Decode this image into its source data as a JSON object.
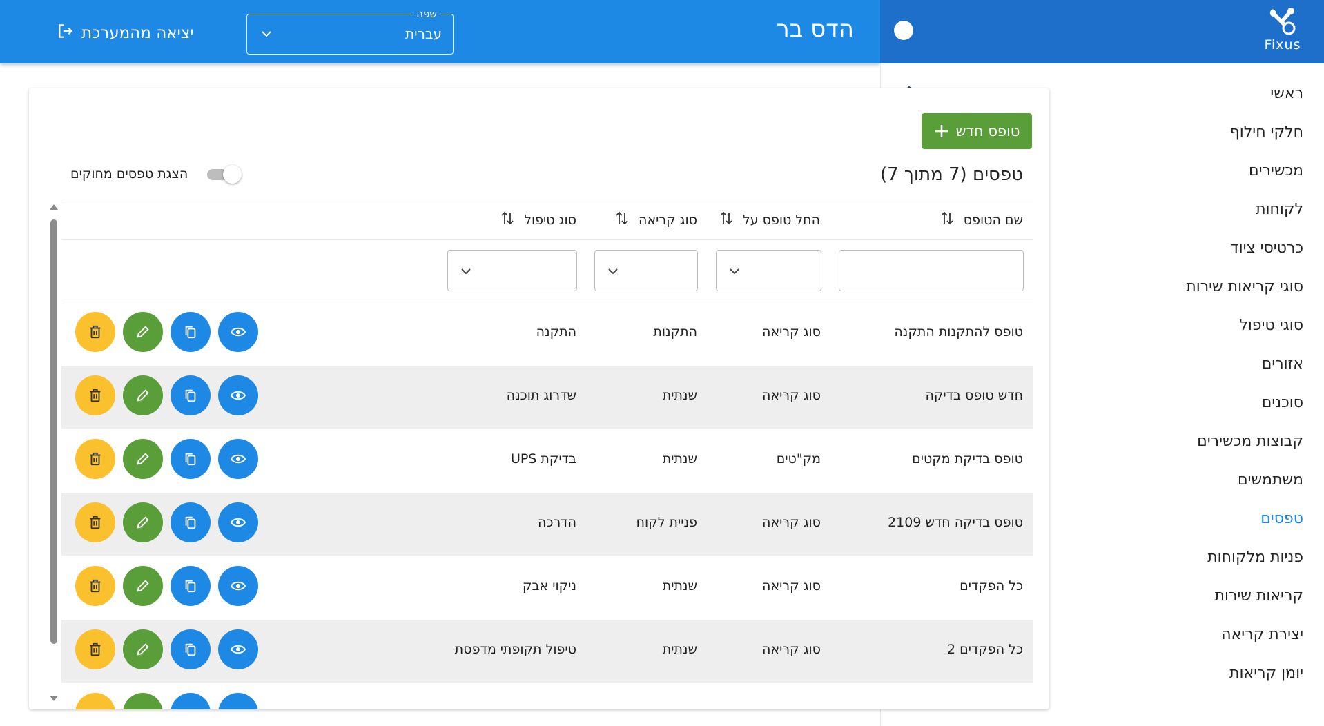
{
  "brand": {
    "logo_text": "Fixus"
  },
  "topbar": {
    "page_heading": "הדס בר",
    "language": {
      "legend": "שפה",
      "value": "עברית"
    },
    "logout_label": "יציאה מהמערכת"
  },
  "sidebar": {
    "items": [
      {
        "label": "ראשי",
        "icon": "home-icon",
        "active": false
      },
      {
        "label": "חלקי חילוף",
        "icon": "tags-icon",
        "active": false
      },
      {
        "label": "מכשירים",
        "icon": "device-icon",
        "active": false
      },
      {
        "label": "לקוחות",
        "icon": "customer-icon",
        "active": false
      },
      {
        "label": "כרטיסי ציוד",
        "icon": "equipment-card-icon",
        "active": false
      },
      {
        "label": "סוגי קריאות שירות",
        "icon": "service-types-icon",
        "active": false
      },
      {
        "label": "סוגי טיפול",
        "icon": "toolbox-icon",
        "active": false
      },
      {
        "label": "אזורים",
        "icon": "globe-icon",
        "active": false
      },
      {
        "label": "סוכנים",
        "icon": "agent-icon",
        "active": false
      },
      {
        "label": "קבוצות מכשירים",
        "icon": "device-groups-icon",
        "active": false
      },
      {
        "label": "משתמשים",
        "icon": "users-icon",
        "active": false
      },
      {
        "label": "טפסים",
        "icon": "edit-form-icon",
        "active": true
      },
      {
        "label": "פניות מלקוחות",
        "icon": "ticket-icon",
        "active": false
      },
      {
        "label": "קריאות שירות",
        "icon": "checklist-icon",
        "active": false
      },
      {
        "label": "יצירת קריאה",
        "icon": "plus-icon",
        "active": false
      },
      {
        "label": "יומן קריאות",
        "icon": "calendar-icon",
        "active": false
      }
    ]
  },
  "main": {
    "new_button_label": "טופס חדש",
    "table_title": "טפסים (7 מתוך 7)",
    "toggle_label": "הצגת טפסים מחוקים",
    "columns": [
      "שם הטופס",
      "החל טופס על",
      "סוג קריאה",
      "סוג טיפול"
    ],
    "rows": [
      [
        "טופס להתקנות התקנה",
        "סוג קריאה",
        "התקנות",
        "התקנה"
      ],
      [
        "חדש טופס בדיקה",
        "סוג קריאה",
        "שנתית",
        "שדרוג תוכנה"
      ],
      [
        "טופס בדיקת מקטים",
        "מק\"טים",
        "שנתית",
        "בדיקת UPS"
      ],
      [
        "טופס בדיקה חדש 2109",
        "סוג קריאה",
        "פניית לקוח",
        "הדרכה"
      ],
      [
        "כל הפקדים",
        "סוג קריאה",
        "שנתית",
        "ניקוי אבק"
      ],
      [
        "כל הפקדים 2",
        "סוג קריאה",
        "שנתית",
        "טיפול תקופתי מדפסת"
      ]
    ]
  },
  "colors": {
    "topbar": "#1e88e5",
    "brand": "#1e6fc9",
    "active_nav": "#1e88e5",
    "new_button": "#5a9e3a",
    "view_button": "#1e88e5",
    "copy_button": "#1e88e5",
    "edit_button": "#5a9e3a",
    "delete_button": "#fbc02d"
  }
}
